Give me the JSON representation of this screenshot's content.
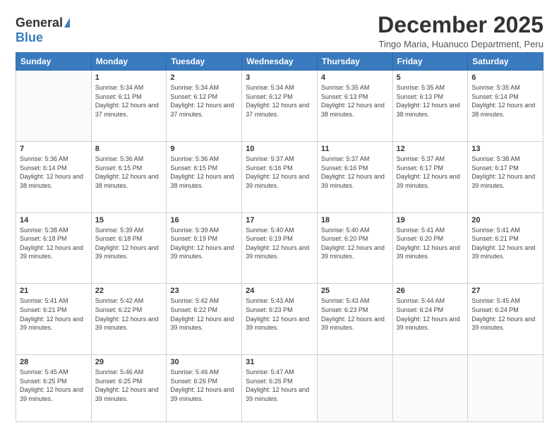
{
  "logo": {
    "general": "General",
    "blue": "Blue"
  },
  "header": {
    "title": "December 2025",
    "location": "Tingo Maria, Huanuco Department, Peru"
  },
  "weekdays": [
    "Sunday",
    "Monday",
    "Tuesday",
    "Wednesday",
    "Thursday",
    "Friday",
    "Saturday"
  ],
  "weeks": [
    [
      {
        "day": "",
        "sunrise": "",
        "sunset": "",
        "daylight": ""
      },
      {
        "day": "1",
        "sunrise": "Sunrise: 5:34 AM",
        "sunset": "Sunset: 6:11 PM",
        "daylight": "Daylight: 12 hours and 37 minutes."
      },
      {
        "day": "2",
        "sunrise": "Sunrise: 5:34 AM",
        "sunset": "Sunset: 6:12 PM",
        "daylight": "Daylight: 12 hours and 37 minutes."
      },
      {
        "day": "3",
        "sunrise": "Sunrise: 5:34 AM",
        "sunset": "Sunset: 6:12 PM",
        "daylight": "Daylight: 12 hours and 37 minutes."
      },
      {
        "day": "4",
        "sunrise": "Sunrise: 5:35 AM",
        "sunset": "Sunset: 6:13 PM",
        "daylight": "Daylight: 12 hours and 38 minutes."
      },
      {
        "day": "5",
        "sunrise": "Sunrise: 5:35 AM",
        "sunset": "Sunset: 6:13 PM",
        "daylight": "Daylight: 12 hours and 38 minutes."
      },
      {
        "day": "6",
        "sunrise": "Sunrise: 5:35 AM",
        "sunset": "Sunset: 6:14 PM",
        "daylight": "Daylight: 12 hours and 38 minutes."
      }
    ],
    [
      {
        "day": "7",
        "sunrise": "Sunrise: 5:36 AM",
        "sunset": "Sunset: 6:14 PM",
        "daylight": "Daylight: 12 hours and 38 minutes."
      },
      {
        "day": "8",
        "sunrise": "Sunrise: 5:36 AM",
        "sunset": "Sunset: 6:15 PM",
        "daylight": "Daylight: 12 hours and 38 minutes."
      },
      {
        "day": "9",
        "sunrise": "Sunrise: 5:36 AM",
        "sunset": "Sunset: 6:15 PM",
        "daylight": "Daylight: 12 hours and 38 minutes."
      },
      {
        "day": "10",
        "sunrise": "Sunrise: 5:37 AM",
        "sunset": "Sunset: 6:16 PM",
        "daylight": "Daylight: 12 hours and 39 minutes."
      },
      {
        "day": "11",
        "sunrise": "Sunrise: 5:37 AM",
        "sunset": "Sunset: 6:16 PM",
        "daylight": "Daylight: 12 hours and 39 minutes."
      },
      {
        "day": "12",
        "sunrise": "Sunrise: 5:37 AM",
        "sunset": "Sunset: 6:17 PM",
        "daylight": "Daylight: 12 hours and 39 minutes."
      },
      {
        "day": "13",
        "sunrise": "Sunrise: 5:38 AM",
        "sunset": "Sunset: 6:17 PM",
        "daylight": "Daylight: 12 hours and 39 minutes."
      }
    ],
    [
      {
        "day": "14",
        "sunrise": "Sunrise: 5:38 AM",
        "sunset": "Sunset: 6:18 PM",
        "daylight": "Daylight: 12 hours and 39 minutes."
      },
      {
        "day": "15",
        "sunrise": "Sunrise: 5:39 AM",
        "sunset": "Sunset: 6:18 PM",
        "daylight": "Daylight: 12 hours and 39 minutes."
      },
      {
        "day": "16",
        "sunrise": "Sunrise: 5:39 AM",
        "sunset": "Sunset: 6:19 PM",
        "daylight": "Daylight: 12 hours and 39 minutes."
      },
      {
        "day": "17",
        "sunrise": "Sunrise: 5:40 AM",
        "sunset": "Sunset: 6:19 PM",
        "daylight": "Daylight: 12 hours and 39 minutes."
      },
      {
        "day": "18",
        "sunrise": "Sunrise: 5:40 AM",
        "sunset": "Sunset: 6:20 PM",
        "daylight": "Daylight: 12 hours and 39 minutes."
      },
      {
        "day": "19",
        "sunrise": "Sunrise: 5:41 AM",
        "sunset": "Sunset: 6:20 PM",
        "daylight": "Daylight: 12 hours and 39 minutes."
      },
      {
        "day": "20",
        "sunrise": "Sunrise: 5:41 AM",
        "sunset": "Sunset: 6:21 PM",
        "daylight": "Daylight: 12 hours and 39 minutes."
      }
    ],
    [
      {
        "day": "21",
        "sunrise": "Sunrise: 5:41 AM",
        "sunset": "Sunset: 6:21 PM",
        "daylight": "Daylight: 12 hours and 39 minutes."
      },
      {
        "day": "22",
        "sunrise": "Sunrise: 5:42 AM",
        "sunset": "Sunset: 6:22 PM",
        "daylight": "Daylight: 12 hours and 39 minutes."
      },
      {
        "day": "23",
        "sunrise": "Sunrise: 5:42 AM",
        "sunset": "Sunset: 6:22 PM",
        "daylight": "Daylight: 12 hours and 39 minutes."
      },
      {
        "day": "24",
        "sunrise": "Sunrise: 5:43 AM",
        "sunset": "Sunset: 6:23 PM",
        "daylight": "Daylight: 12 hours and 39 minutes."
      },
      {
        "day": "25",
        "sunrise": "Sunrise: 5:43 AM",
        "sunset": "Sunset: 6:23 PM",
        "daylight": "Daylight: 12 hours and 39 minutes."
      },
      {
        "day": "26",
        "sunrise": "Sunrise: 5:44 AM",
        "sunset": "Sunset: 6:24 PM",
        "daylight": "Daylight: 12 hours and 39 minutes."
      },
      {
        "day": "27",
        "sunrise": "Sunrise: 5:45 AM",
        "sunset": "Sunset: 6:24 PM",
        "daylight": "Daylight: 12 hours and 39 minutes."
      }
    ],
    [
      {
        "day": "28",
        "sunrise": "Sunrise: 5:45 AM",
        "sunset": "Sunset: 6:25 PM",
        "daylight": "Daylight: 12 hours and 39 minutes."
      },
      {
        "day": "29",
        "sunrise": "Sunrise: 5:46 AM",
        "sunset": "Sunset: 6:25 PM",
        "daylight": "Daylight: 12 hours and 39 minutes."
      },
      {
        "day": "30",
        "sunrise": "Sunrise: 5:46 AM",
        "sunset": "Sunset: 6:26 PM",
        "daylight": "Daylight: 12 hours and 39 minutes."
      },
      {
        "day": "31",
        "sunrise": "Sunrise: 5:47 AM",
        "sunset": "Sunset: 6:26 PM",
        "daylight": "Daylight: 12 hours and 39 minutes."
      },
      {
        "day": "",
        "sunrise": "",
        "sunset": "",
        "daylight": ""
      },
      {
        "day": "",
        "sunrise": "",
        "sunset": "",
        "daylight": ""
      },
      {
        "day": "",
        "sunrise": "",
        "sunset": "",
        "daylight": ""
      }
    ]
  ]
}
